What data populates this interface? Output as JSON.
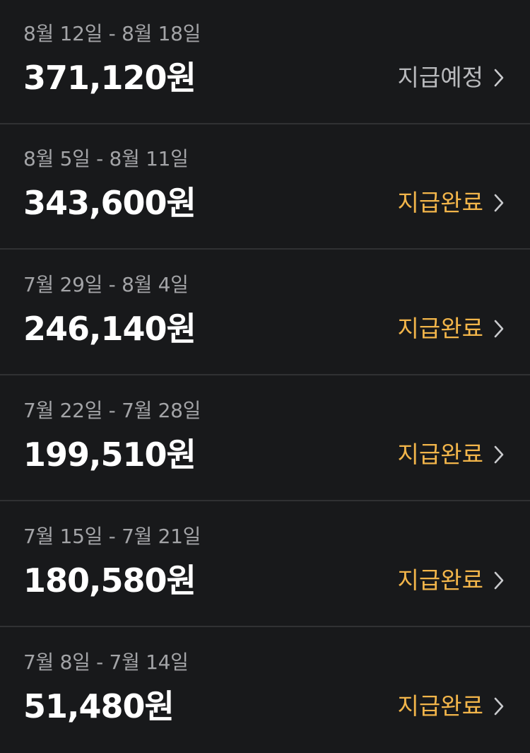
{
  "colors": {
    "background": "#18191b",
    "divider": "#303133",
    "period_text": "#a3a4a7",
    "amount_text": "#ffffff",
    "status_scheduled": "#b9babd",
    "status_completed": "#f2b54a",
    "chevron": "#c9cacd"
  },
  "icons": {
    "chevron": "chevron-right-icon"
  },
  "payouts": [
    {
      "period": "8월 12일 - 8월 18일",
      "amount": "371,120원",
      "status": "지급예정",
      "status_type": "scheduled"
    },
    {
      "period": "8월 5일 - 8월 11일",
      "amount": "343,600원",
      "status": "지급완료",
      "status_type": "completed"
    },
    {
      "period": "7월 29일 - 8월 4일",
      "amount": "246,140원",
      "status": "지급완료",
      "status_type": "completed"
    },
    {
      "period": "7월 22일 - 7월 28일",
      "amount": "199,510원",
      "status": "지급완료",
      "status_type": "completed"
    },
    {
      "period": "7월 15일 - 7월 21일",
      "amount": "180,580원",
      "status": "지급완료",
      "status_type": "completed"
    },
    {
      "period": "7월 8일 - 7월 14일",
      "amount": "51,480원",
      "status": "지급완료",
      "status_type": "completed"
    }
  ]
}
